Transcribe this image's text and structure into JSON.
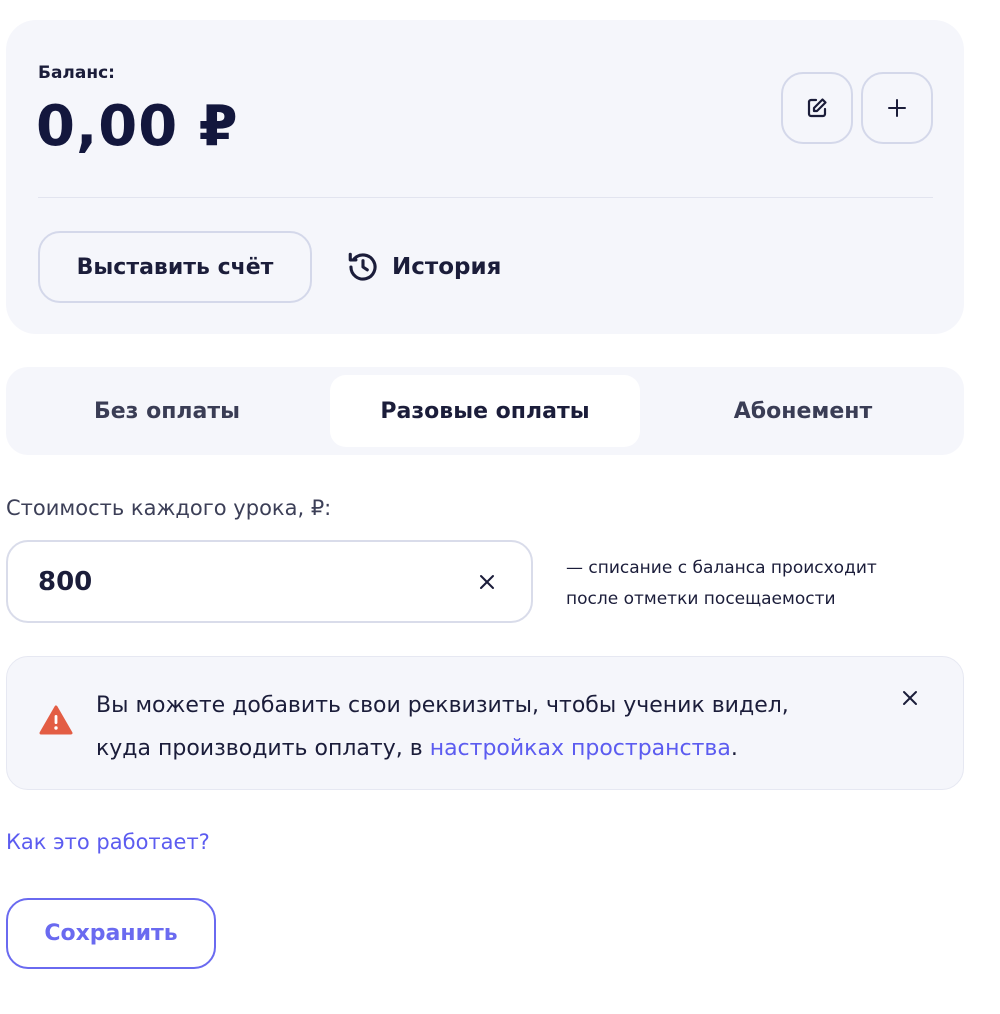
{
  "balance": {
    "label": "Баланс:",
    "amount": "0,00 ₽",
    "edit_icon": "edit-icon",
    "add_icon": "plus-icon",
    "invoice_button": "Выставить счёт",
    "history_label": "История",
    "history_icon": "history-clock-icon"
  },
  "tabs": [
    {
      "label": "Без оплаты",
      "active": false
    },
    {
      "label": "Разовые оплаты",
      "active": true
    },
    {
      "label": "Абонемент",
      "active": false
    }
  ],
  "cost": {
    "label": "Стоимость каждого урока, ₽:",
    "value": "800",
    "hint_line1": "— списание с баланса происходит",
    "hint_line2": "после отметки посещаемости"
  },
  "alert": {
    "text_part1": "Вы можете добавить свои реквизиты, чтобы ученик видел,",
    "text_part2": "куда производить оплату, в ",
    "link_text": "настройках пространства",
    "text_end": ".",
    "warning_color": "#e35d44"
  },
  "help_link": "Как это работает?",
  "save_button": "Сохранить",
  "colors": {
    "accent": "#5c5cf0",
    "text": "#1b1d3a",
    "panel": "#f5f6fb"
  }
}
